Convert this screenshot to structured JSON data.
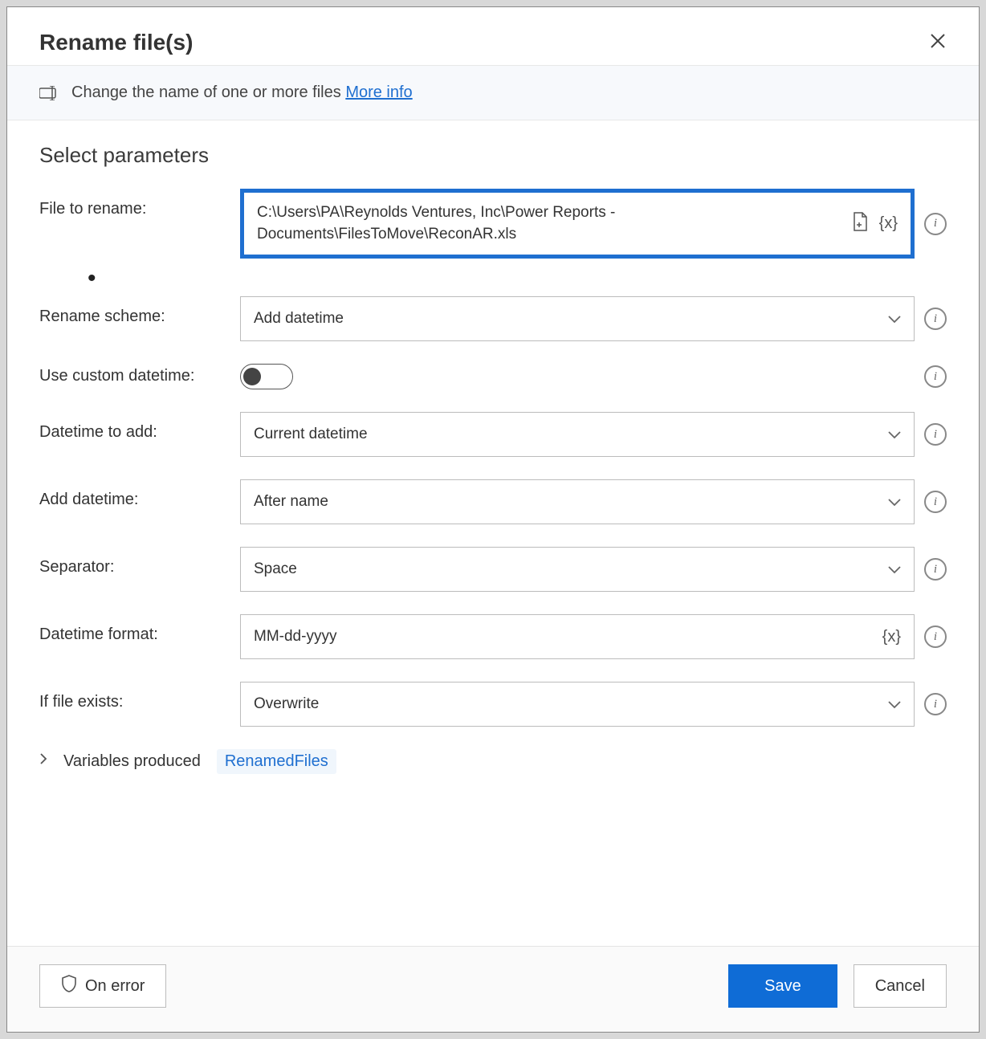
{
  "header": {
    "title": "Rename file(s)"
  },
  "subheader": {
    "text": "Change the name of one or more files ",
    "link": "More info"
  },
  "section_title": "Select parameters",
  "fields": {
    "file_to_rename": {
      "label": "File to rename:",
      "value": "C:\\Users\\PA\\Reynolds Ventures, Inc\\Power Reports - Documents\\FilesToMove\\ReconAR.xls"
    },
    "rename_scheme": {
      "label": "Rename scheme:",
      "value": "Add datetime"
    },
    "use_custom": {
      "label": "Use custom datetime:"
    },
    "datetime_to_add": {
      "label": "Datetime to add:",
      "value": "Current datetime"
    },
    "add_datetime": {
      "label": "Add datetime:",
      "value": "After name"
    },
    "separator": {
      "label": "Separator:",
      "value": "Space"
    },
    "datetime_format": {
      "label": "Datetime format:",
      "value": "MM-dd-yyyy"
    },
    "if_exists": {
      "label": "If file exists:",
      "value": "Overwrite"
    }
  },
  "variables": {
    "label": "Variables produced",
    "tag": "RenamedFiles"
  },
  "footer": {
    "on_error": "On error",
    "save": "Save",
    "cancel": "Cancel"
  },
  "glyphs": {
    "vx": "{x}"
  }
}
